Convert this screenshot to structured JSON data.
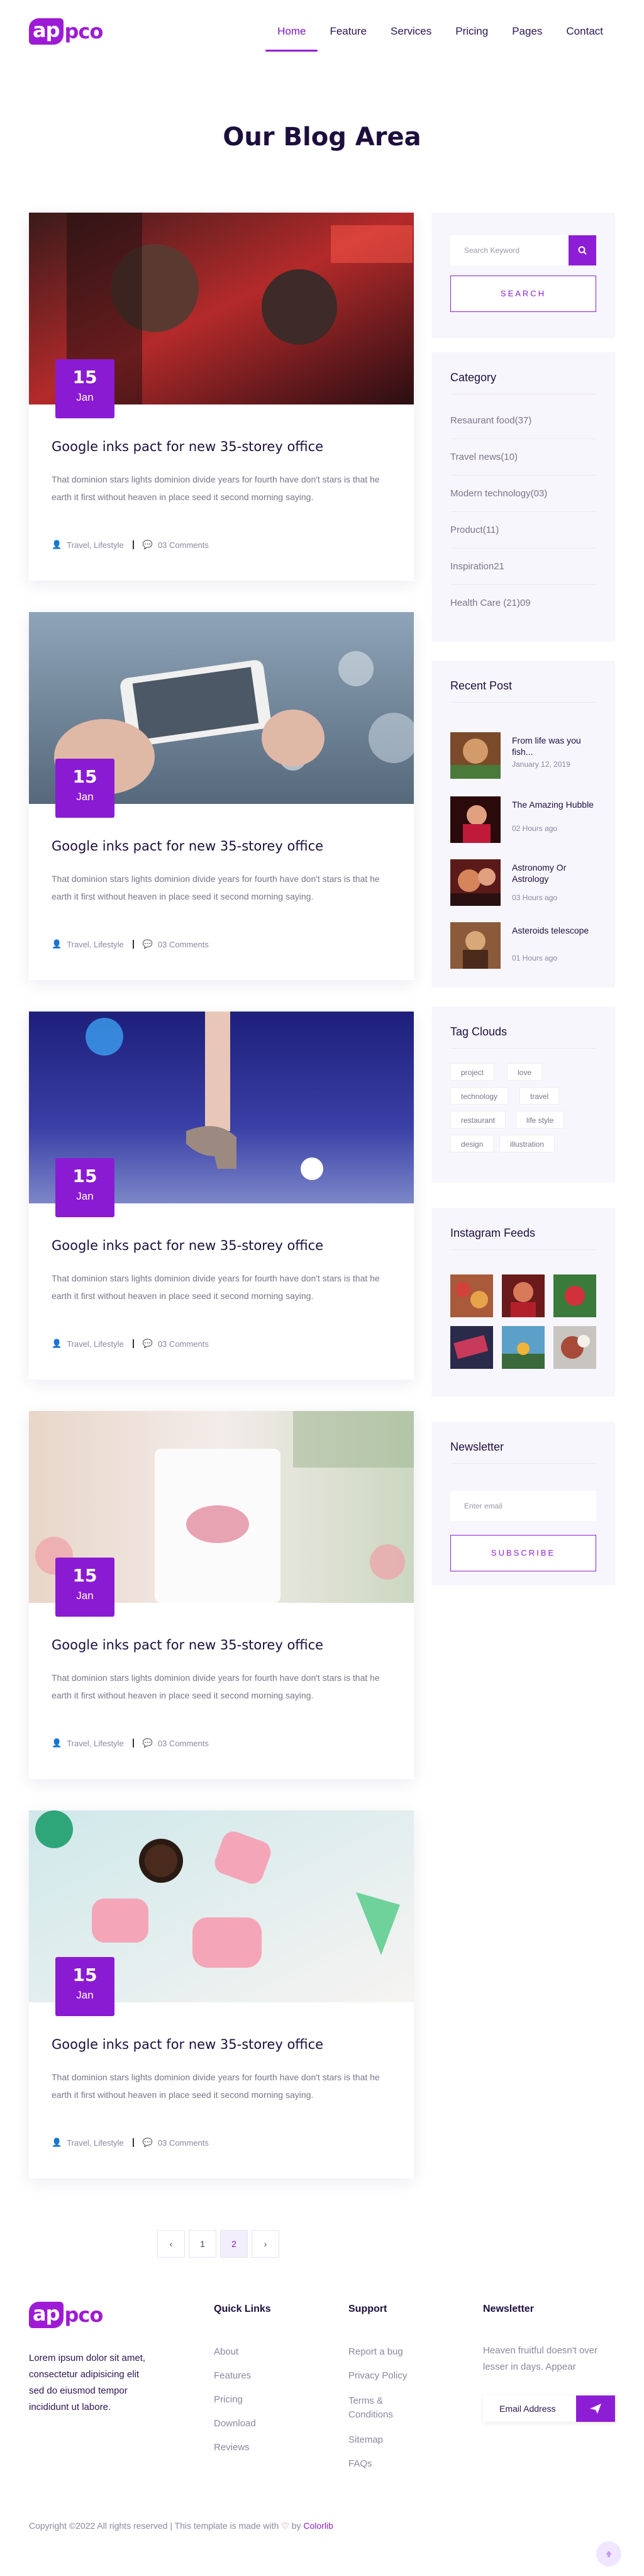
{
  "header": {
    "logo": {
      "part1": "ap",
      "part2": "pco"
    },
    "nav": [
      "Home",
      "Feature",
      "Services",
      "Pricing",
      "Pages",
      "Contact"
    ],
    "active": "Home"
  },
  "page_title": "Our Blog Area",
  "posts": [
    {
      "day": "15",
      "month": "Jan",
      "title": "Google inks pact for new 35-storey office",
      "excerpt": "That dominion stars lights dominion divide years for fourth have don't stars is that he earth it first without heaven in place seed it second morning saying.",
      "categories": "Travel, Lifestyle",
      "comments": "03 Comments"
    },
    {
      "day": "15",
      "month": "Jan",
      "title": "Google inks pact for new 35-storey office",
      "excerpt": "That dominion stars lights dominion divide years for fourth have don't stars is that he earth it first without heaven in place seed it second morning saying.",
      "categories": "Travel, Lifestyle",
      "comments": "03 Comments"
    },
    {
      "day": "15",
      "month": "Jan",
      "title": "Google inks pact for new 35-storey office",
      "excerpt": "That dominion stars lights dominion divide years for fourth have don't stars is that he earth it first without heaven in place seed it second morning saying.",
      "categories": "Travel, Lifestyle",
      "comments": "03 Comments"
    },
    {
      "day": "15",
      "month": "Jan",
      "title": "Google inks pact for new 35-storey office",
      "excerpt": "That dominion stars lights dominion divide years for fourth have don't stars is that he earth it first without heaven in place seed it second morning saying.",
      "categories": "Travel, Lifestyle",
      "comments": "03 Comments"
    },
    {
      "day": "15",
      "month": "Jan",
      "title": "Google inks pact for new 35-storey office",
      "excerpt": "That dominion stars lights dominion divide years for fourth have don't stars is that he earth it first without heaven in place seed it second morning saying.",
      "categories": "Travel, Lifestyle",
      "comments": "03 Comments"
    }
  ],
  "pagination": {
    "prev": "‹",
    "pages": [
      "1",
      "2"
    ],
    "active": "2",
    "next": "›"
  },
  "sidebar": {
    "search": {
      "placeholder": "Search Keyword",
      "button": "SEARCH"
    },
    "category": {
      "title": "Category",
      "items": [
        "Resaurant food(37)",
        "Travel news(10)",
        "Modern technology(03)",
        "Product(11)",
        "Inspiration21",
        "Health Care (21)09"
      ]
    },
    "recent": {
      "title": "Recent Post",
      "items": [
        {
          "title": "From life was you fish...",
          "date": "January 12, 2019"
        },
        {
          "title": "The Amazing Hubble",
          "date": "02 Hours ago"
        },
        {
          "title": "Astronomy Or Astrology",
          "date": "03 Hours ago"
        },
        {
          "title": "Asteroids telescope",
          "date": "01 Hours ago"
        }
      ]
    },
    "tags": {
      "title": "Tag Clouds",
      "items": [
        "project",
        "love",
        "technology",
        "travel",
        "restaurant",
        "life style",
        "design",
        "illustration"
      ]
    },
    "instagram": {
      "title": "Instagram Feeds"
    },
    "newsletter": {
      "title": "Newsletter",
      "placeholder": "Enter email",
      "button": "SUBSCRIBE"
    }
  },
  "footer": {
    "about": "Lorem ipsum dolor sit amet, consectetur adipisicing elit sed do eiusmod tempor incididunt ut labore.",
    "quick_links": {
      "title": "Quick Links",
      "items": [
        "About",
        "Features",
        "Pricing",
        "Download",
        "Reviews"
      ]
    },
    "support": {
      "title": "Support",
      "items": [
        "Report a bug",
        "Privacy Policy",
        "Terms & Conditions",
        "Sitemap",
        "FAQs"
      ]
    },
    "newsletter": {
      "title": "Newsletter",
      "text": "Heaven fruitful doesn't over lesser in days. Appear",
      "placeholder": "Email Address"
    },
    "copyright": {
      "pre": "Copyright ©2022 All rights reserved | This template is made with",
      "by": "by",
      "brand": "Colorlib"
    }
  },
  "colors": {
    "accent": "#8e1ed6",
    "title": "#1c0e3d",
    "body": "#7a7488"
  }
}
